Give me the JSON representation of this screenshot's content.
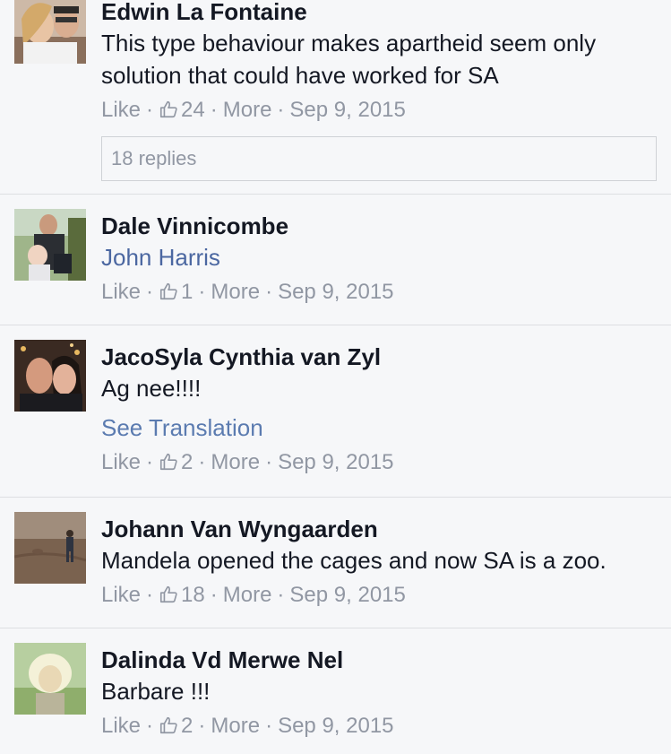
{
  "comments": [
    {
      "name": "Edwin La Fontaine",
      "text": "This type behaviour makes apartheid seem only solution that could have worked for SA",
      "like_label": "Like",
      "like_count": "24",
      "more_label": "More",
      "date": "Sep 9, 2015",
      "replies": "18 replies"
    },
    {
      "name": "Dale Vinnicombe",
      "mention": "John Harris",
      "like_label": "Like",
      "like_count": "1",
      "more_label": "More",
      "date": "Sep 9, 2015"
    },
    {
      "name": "JacoSyla Cynthia van Zyl",
      "text": "Ag nee!!!!",
      "translation_link": "See Translation",
      "like_label": "Like",
      "like_count": "2",
      "more_label": "More",
      "date": "Sep 9, 2015"
    },
    {
      "name": "Johann Van Wyngaarden",
      "text": "Mandela opened the cages and now SA is a zoo.",
      "like_label": "Like",
      "like_count": "18",
      "more_label": "More",
      "date": "Sep 9, 2015"
    },
    {
      "name": "Dalinda Vd Merwe Nel",
      "text": "Barbare !!!",
      "like_label": "Like",
      "like_count": "2",
      "more_label": "More",
      "date": "Sep 9, 2015"
    }
  ],
  "colors": {
    "background": "#f6f7f9",
    "name_text": "#141823",
    "link_blue": "#4b67a1",
    "meta_gray": "#9197a3",
    "divider": "#dddfe2"
  },
  "icons": {
    "like_count_icon": "thumbs-up-icon"
  }
}
